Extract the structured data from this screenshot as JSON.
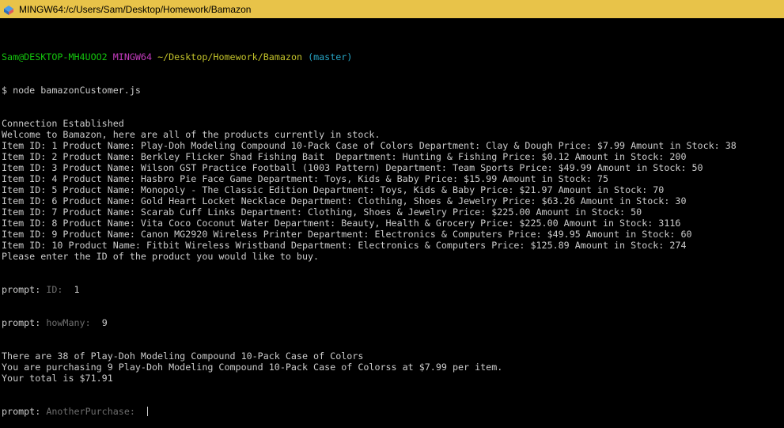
{
  "window": {
    "title": "MINGW64:/c/Users/Sam/Desktop/Homework/Bamazon",
    "titlebar_color": "#e8c349",
    "icon": "mingw-icon"
  },
  "prompt_line": {
    "user_host": "Sam@DESKTOP-MH4UOO2",
    "msystem": "MINGW64",
    "path": "~/Desktop/Homework/Bamazon",
    "branch": "(master)",
    "colors": {
      "user_host": "#13c40d",
      "msystem": "#c53cbf",
      "path": "#c2c22a",
      "branch": "#27a5c5"
    }
  },
  "command": "$ node bamazonCustomer.js",
  "output_lines": [
    "Connection Established",
    "Welcome to Bamazon, here are all of the products currently in stock.",
    "Item ID: 1 Product Name: Play-Doh Modeling Compound 10-Pack Case of Colors Department: Clay & Dough Price: $7.99 Amount in Stock: 38",
    "Item ID: 2 Product Name: Berkley Flicker Shad Fishing Bait  Department: Hunting & Fishing Price: $0.12 Amount in Stock: 200",
    "Item ID: 3 Product Name: Wilson GST Practice Football (1003 Pattern) Department: Team Sports Price: $49.99 Amount in Stock: 50",
    "Item ID: 4 Product Name: Hasbro Pie Face Game Department: Toys, Kids & Baby Price: $15.99 Amount in Stock: 75",
    "Item ID: 5 Product Name: Monopoly - The Classic Edition Department: Toys, Kids & Baby Price: $21.97 Amount in Stock: 70",
    "Item ID: 6 Product Name: Gold Heart Locket Necklace Department: Clothing, Shoes & Jewelry Price: $63.26 Amount in Stock: 30",
    "Item ID: 7 Product Name: Scarab Cuff Links Department: Clothing, Shoes & Jewelry Price: $225.00 Amount in Stock: 50",
    "Item ID: 8 Product Name: Vita Coco Coconut Water Department: Beauty, Health & Grocery Price: $225.00 Amount in Stock: 3116",
    "Item ID: 9 Product Name: Canon MG2920 Wireless Printer Department: Electronics & Computers Price: $49.95 Amount in Stock: 60",
    "Item ID: 10 Product Name: Fitbit Wireless Wristband Department: Electronics & Computers Price: $125.89 Amount in Stock: 274",
    "Please enter the ID of the product you would like to buy."
  ],
  "prompts": {
    "id": {
      "prefix": "prompt:",
      "label": "ID:",
      "value": "1"
    },
    "how_many": {
      "prefix": "prompt:",
      "label": "howMany:",
      "value": "9"
    }
  },
  "result_lines": [
    "There are 38 of Play-Doh Modeling Compound 10-Pack Case of Colors",
    "You are purchasing 9 Play-Doh Modeling Compound 10-Pack Case of Colorss at $7.99 per item.",
    "Your total is $71.91"
  ],
  "final_prompt": {
    "prefix": "prompt:",
    "label": "AnotherPurchase:"
  }
}
